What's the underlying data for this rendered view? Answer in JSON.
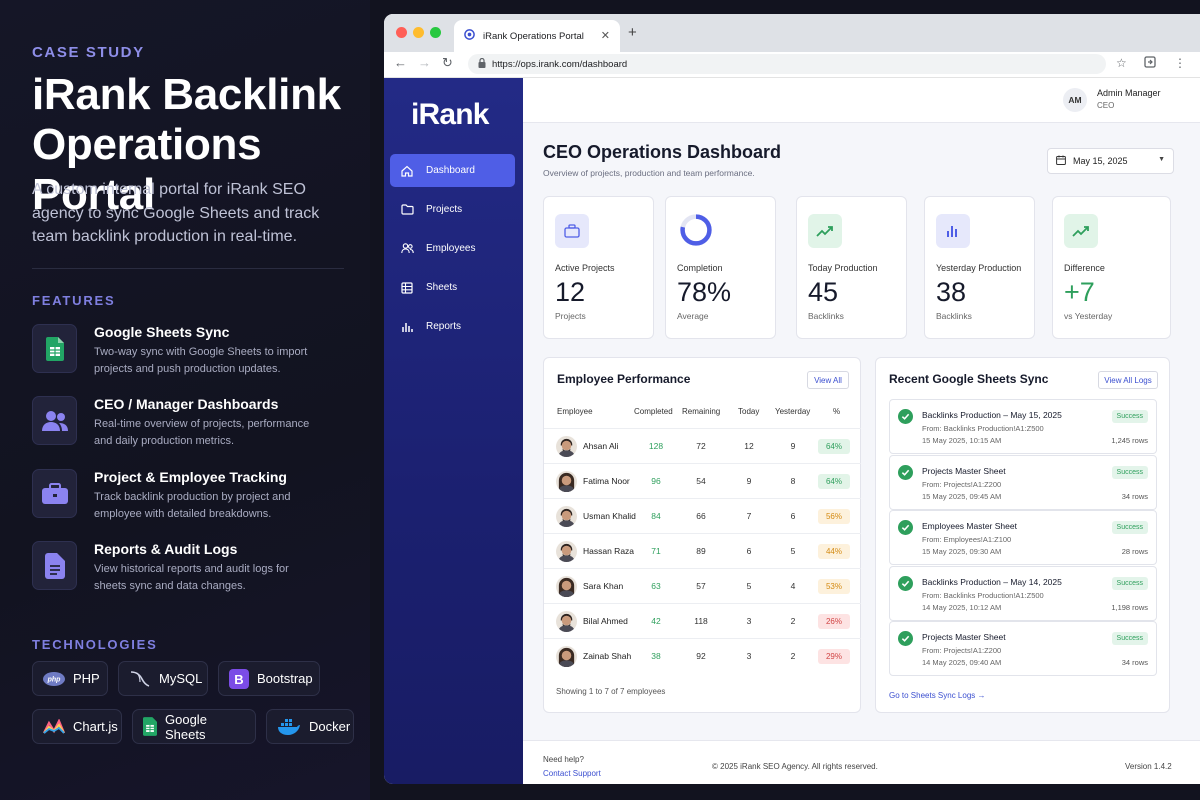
{
  "left": {
    "kicker": "CASE STUDY",
    "title_line1": "iRank Backlink",
    "title_line2": "Operations Portal",
    "description": "A custom internal portal for iRank SEO agency to sync Google Sheets and track team backlink production in real-time.",
    "features_heading": "FEATURES",
    "features": [
      {
        "icon": "google-sheets-icon",
        "title": "Google Sheets Sync",
        "desc": "Two-way sync with Google Sheets to import projects and push production updates."
      },
      {
        "icon": "users-icon",
        "title": "CEO / Manager Dashboards",
        "desc": "Real-time overview of projects, performance and daily production metrics."
      },
      {
        "icon": "briefcase-icon",
        "title": "Project & Employee Tracking",
        "desc": "Track backlink production by project and employee with detailed breakdowns."
      },
      {
        "icon": "document-icon",
        "title": "Reports & Audit Logs",
        "desc": "View historical reports and audit logs for sheets sync and data changes."
      }
    ],
    "technologies_heading": "TECHNOLOGIES",
    "technologies": [
      {
        "icon": "php-icon",
        "label": "PHP",
        "logo_text": "php"
      },
      {
        "icon": "mysql-icon",
        "label": "MySQL"
      },
      {
        "icon": "bootstrap-icon",
        "label": "Bootstrap",
        "logo_text": "B"
      },
      {
        "icon": "chartjs-icon",
        "label": "Chart.js"
      },
      {
        "icon": "google-sheets-icon",
        "label": "Google Sheets"
      },
      {
        "icon": "docker-icon",
        "label": "Docker"
      }
    ],
    "colors": {
      "accent": "#7f7fe0",
      "background": "#12131f"
    }
  },
  "browser": {
    "tab_title": "iRank Operations Portal",
    "url": "https://ops.irank.com/dashboard"
  },
  "sidebar": {
    "logo": "iRank",
    "items": [
      {
        "label": "Dashboard",
        "icon": "home-icon",
        "active": true
      },
      {
        "label": "Projects",
        "icon": "folder-icon",
        "active": false
      },
      {
        "label": "Employees",
        "icon": "users-icon",
        "active": false
      },
      {
        "label": "Sheets",
        "icon": "table-icon",
        "active": false
      },
      {
        "label": "Reports",
        "icon": "bar-chart-icon",
        "active": false
      }
    ],
    "colors": {
      "background": "#232a86",
      "active": "#4f5ee6"
    }
  },
  "header": {
    "avatar_initials": "AM",
    "user_name": "Admin Manager",
    "user_role": "CEO"
  },
  "dashboard": {
    "title": "CEO Operations Dashboard",
    "subtitle": "Overview of projects, production and team performance.",
    "date": "May 15, 2025",
    "stats": [
      {
        "label": "Active Projects",
        "value": "12",
        "sub": "Projects",
        "icon": "briefcase-icon"
      },
      {
        "label": "Completion",
        "value": "78%",
        "sub": "Average",
        "icon": "donut-progress-icon",
        "progress": 0.78
      },
      {
        "label": "Today Production",
        "value": "45",
        "sub": "Backlinks",
        "icon": "trend-up-icon"
      },
      {
        "label": "Yesterday Production",
        "value": "38",
        "sub": "Backlinks",
        "icon": "bar-chart-icon"
      },
      {
        "label": "Difference",
        "value": "+7",
        "sub": "vs Yesterday",
        "icon": "trend-up-icon"
      }
    ]
  },
  "employee_performance": {
    "title": "Employee Performance",
    "view_all": "View All",
    "columns": [
      "Employee",
      "Completed",
      "Remaining",
      "Today",
      "Yesterday",
      "%"
    ],
    "rows": [
      {
        "name": "Ahsan Ali",
        "completed": "128",
        "remaining": "72",
        "today": "12",
        "yesterday": "9",
        "pct": "64%",
        "gender": "m"
      },
      {
        "name": "Fatima Noor",
        "completed": "96",
        "remaining": "54",
        "today": "9",
        "yesterday": "8",
        "pct": "64%",
        "gender": "f"
      },
      {
        "name": "Usman Khalid",
        "completed": "84",
        "remaining": "66",
        "today": "7",
        "yesterday": "6",
        "pct": "56%",
        "gender": "m"
      },
      {
        "name": "Hassan Raza",
        "completed": "71",
        "remaining": "89",
        "today": "6",
        "yesterday": "5",
        "pct": "44%",
        "gender": "m"
      },
      {
        "name": "Sara Khan",
        "completed": "63",
        "remaining": "57",
        "today": "5",
        "yesterday": "4",
        "pct": "53%",
        "gender": "f"
      },
      {
        "name": "Bilal Ahmed",
        "completed": "42",
        "remaining": "118",
        "today": "3",
        "yesterday": "2",
        "pct": "26%",
        "gender": "m"
      },
      {
        "name": "Zainab Shah",
        "completed": "38",
        "remaining": "92",
        "today": "3",
        "yesterday": "2",
        "pct": "29%",
        "gender": "f"
      }
    ],
    "footer": "Showing 1 to 7 of 7 employees"
  },
  "sync_logs": {
    "title": "Recent Google Sheets Sync",
    "view_all": "View All Logs",
    "items": [
      {
        "title": "Backlinks Production – May 15, 2025",
        "source": "From: Backlinks Production!A1:Z500",
        "time": "15 May 2025, 10:15 AM",
        "status": "Success",
        "rows": "1,245 rows"
      },
      {
        "title": "Projects Master Sheet",
        "source": "From: Projects!A1:Z200",
        "time": "15 May 2025, 09:45 AM",
        "status": "Success",
        "rows": "34 rows"
      },
      {
        "title": "Employees Master Sheet",
        "source": "From: Employees!A1:Z100",
        "time": "15 May 2025, 09:30 AM",
        "status": "Success",
        "rows": "28 rows"
      },
      {
        "title": "Backlinks Production – May 14, 2025",
        "source": "From: Backlinks Production!A1:Z500",
        "time": "14 May 2025, 10:12 AM",
        "status": "Success",
        "rows": "1,198 rows"
      },
      {
        "title": "Projects Master Sheet",
        "source": "From: Projects!A1:Z200",
        "time": "14 May 2025, 09:40 AM",
        "status": "Success",
        "rows": "34 rows"
      }
    ],
    "link": "Go to Sheets Sync Logs →"
  },
  "footer": {
    "help": "Need help?",
    "contact": "Contact Support",
    "copyright": "© 2025 iRank SEO Agency.  All rights reserved.",
    "version": "Version 1.4.2"
  }
}
